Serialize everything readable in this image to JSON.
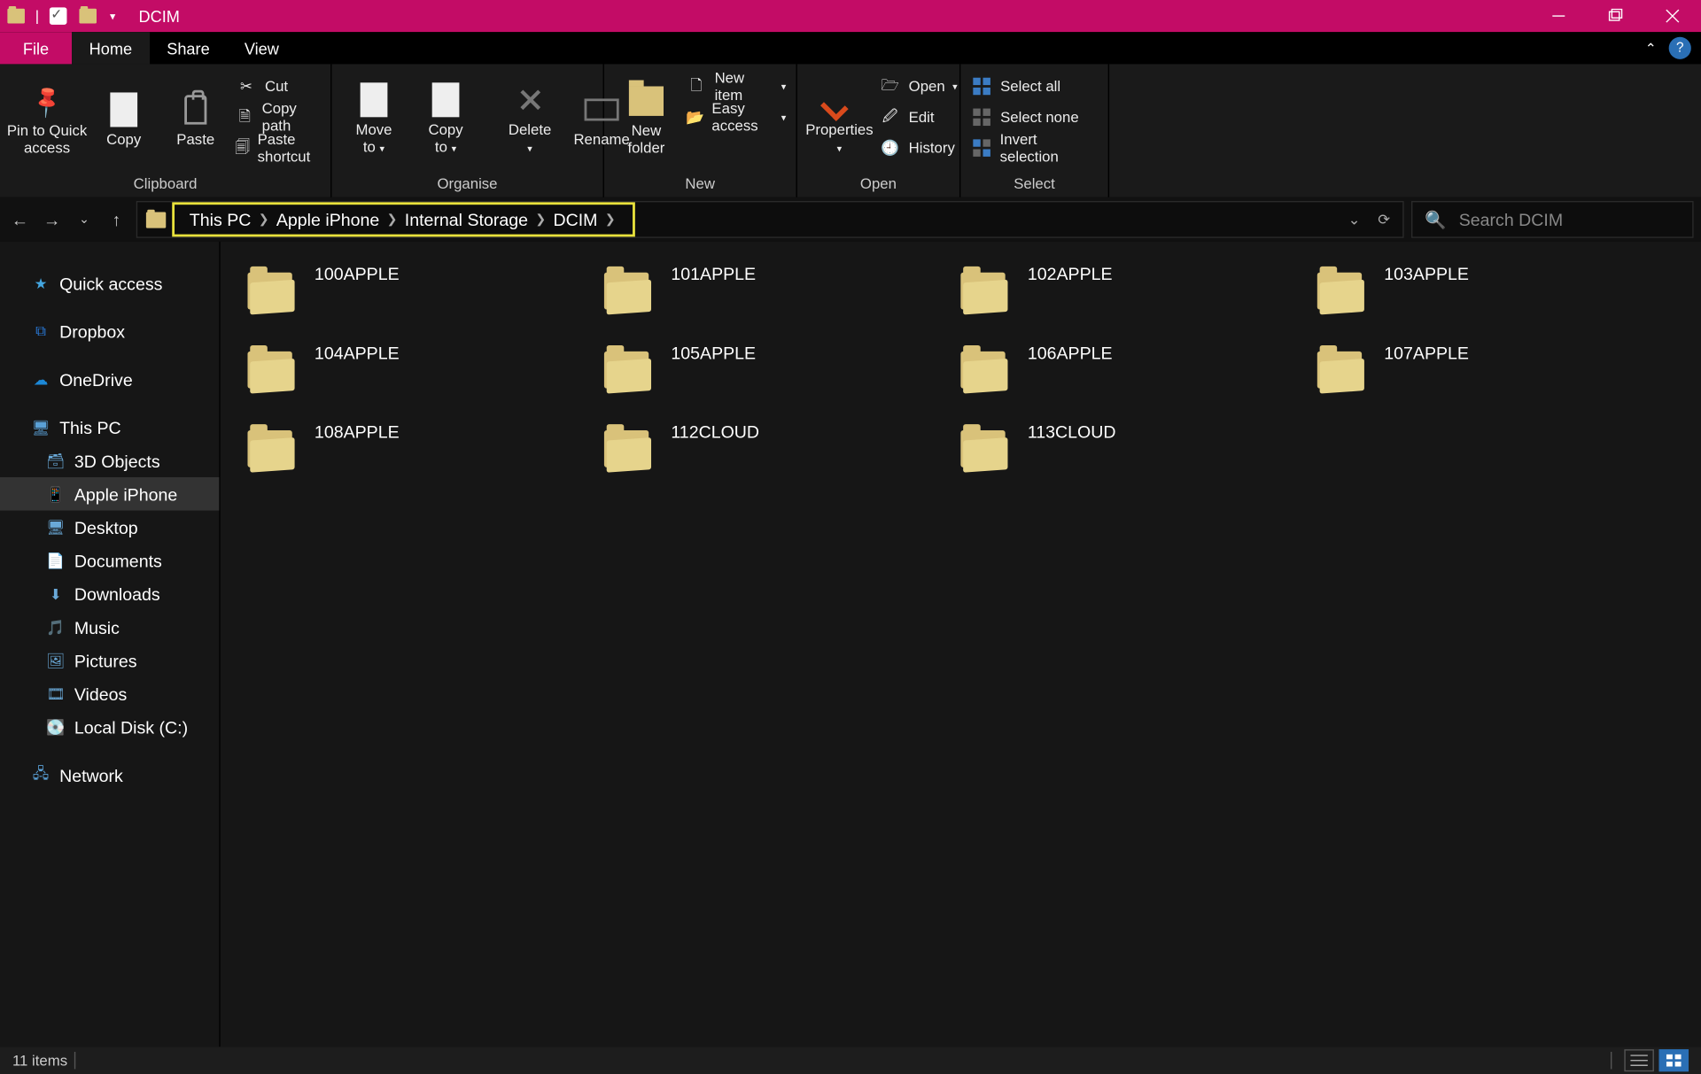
{
  "title": "DCIM",
  "menu": {
    "file": "File",
    "tabs": [
      "Home",
      "Share",
      "View"
    ],
    "active": 0
  },
  "ribbon": {
    "clipboard": {
      "label": "Clipboard",
      "pin": "Pin to Quick access",
      "copy": "Copy",
      "paste": "Paste",
      "cut": "Cut",
      "copy_path": "Copy path",
      "paste_shortcut": "Paste shortcut"
    },
    "organise": {
      "label": "Organise",
      "move_to": "Move to",
      "copy_to": "Copy to",
      "delete": "Delete",
      "rename": "Rename"
    },
    "new": {
      "label": "New",
      "new_folder": "New folder",
      "new_item": "New item",
      "easy_access": "Easy access"
    },
    "open": {
      "label": "Open",
      "properties": "Properties",
      "open": "Open",
      "edit": "Edit",
      "history": "History"
    },
    "select": {
      "label": "Select",
      "select_all": "Select all",
      "select_none": "Select none",
      "invert": "Invert selection"
    }
  },
  "breadcrumb": {
    "items": [
      "This PC",
      "Apple iPhone",
      "Internal Storage",
      "DCIM"
    ]
  },
  "search": {
    "placeholder": "Search DCIM"
  },
  "nav": {
    "quick_access": "Quick access",
    "dropbox": "Dropbox",
    "onedrive": "OneDrive",
    "this_pc": "This PC",
    "children": [
      "3D Objects",
      "Apple iPhone",
      "Desktop",
      "Documents",
      "Downloads",
      "Music",
      "Pictures",
      "Videos",
      "Local Disk (C:)"
    ],
    "selected_child": 1,
    "network": "Network"
  },
  "folders": [
    "100APPLE",
    "101APPLE",
    "102APPLE",
    "103APPLE",
    "104APPLE",
    "105APPLE",
    "106APPLE",
    "107APPLE",
    "108APPLE",
    "112CLOUD",
    "113CLOUD"
  ],
  "status": {
    "items": "11 items"
  },
  "colors": {
    "accent": "#c30c66",
    "highlight": "#e9e23c",
    "blue": "#3b7cc4"
  }
}
